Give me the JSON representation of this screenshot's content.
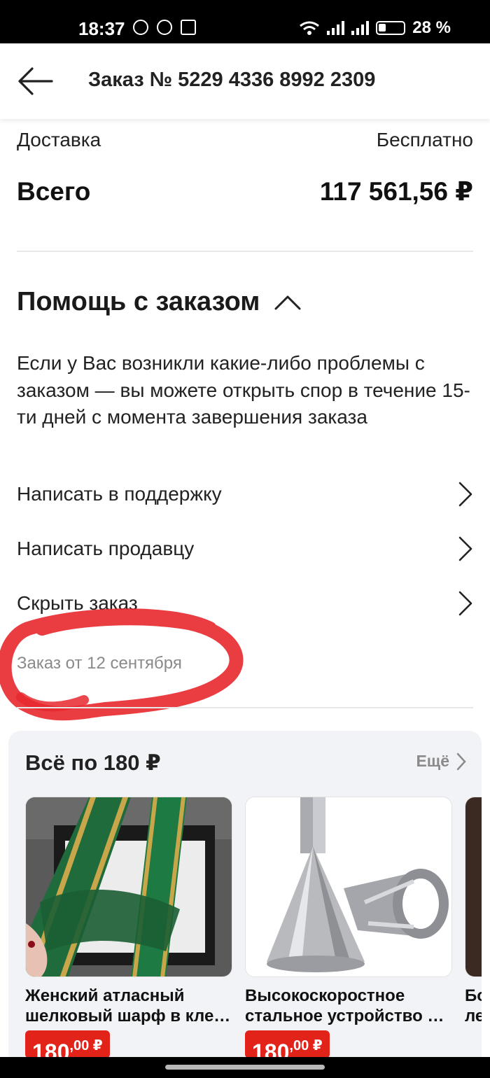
{
  "status_bar": {
    "time": "18:37",
    "battery": "28 %"
  },
  "header": {
    "title": "Заказ № 5229 4336 8992 2309"
  },
  "summary": {
    "delivery_label": "Доставка",
    "delivery_value": "Бесплатно",
    "total_label": "Всего",
    "total_value": "117 561,56 ₽"
  },
  "help": {
    "title": "Помощь с заказом",
    "description": "Если у Вас возникли какие-либо проблемы с заказом — вы можете открыть спор в течение 15-ти дней с момента завершения заказа",
    "links": [
      "Написать в поддержку",
      "Написать продавцу",
      "Скрыть заказ"
    ],
    "order_date": "Заказ от 12 сентября"
  },
  "recommendations": {
    "title": "Всё по 180 ₽",
    "more_label": "Ещё",
    "products": [
      {
        "name_line1": "Женский атласный",
        "name_line2": "шелковый шарф в кле…",
        "price_int": "180",
        "price_frac": ",00 ₽"
      },
      {
        "name_line1": "Высокоскоростное",
        "name_line2": "стальное устройство …",
        "price_int": "180",
        "price_frac": ",00 ₽"
      },
      {
        "name_line1": "Бо",
        "name_line2": "ле"
      }
    ]
  },
  "colors": {
    "accent_red": "#e2231a",
    "scribble_red": "#e8282e",
    "muted_text": "#8a8a8a"
  }
}
